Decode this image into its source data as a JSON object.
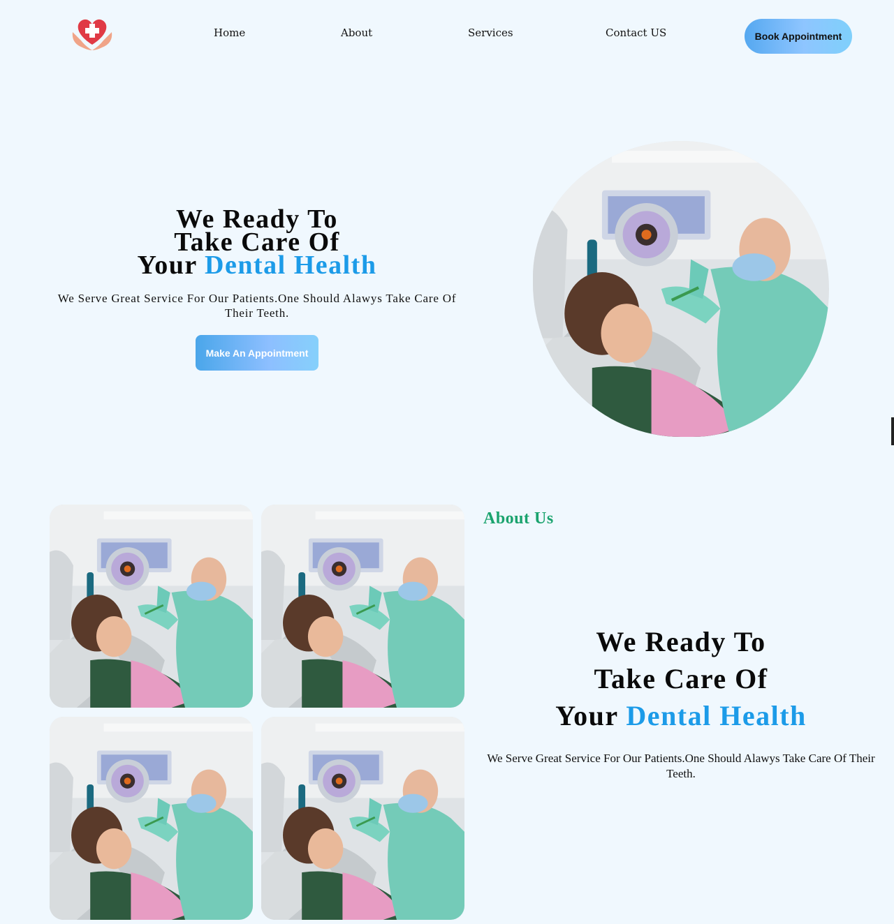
{
  "nav": {
    "links": [
      {
        "label": "Home"
      },
      {
        "label": "About"
      },
      {
        "label": "Services"
      },
      {
        "label": "Contact US"
      }
    ],
    "cta_label": "Book Appointment"
  },
  "hero": {
    "title_line1": "We Ready To",
    "title_line2": "Take Care Of",
    "title_line3_plain": "Your",
    "title_line3_accent": "Dental Health",
    "subtitle": "We Serve Great Service For Our Patients.One Should Alawys Take Care Of Their Teeth.",
    "button_label": "Make An Appointment"
  },
  "about": {
    "section_label": "About Us",
    "title_line1": "We Ready To",
    "title_line2": "Take Care Of",
    "title_line3_plain": "Your",
    "title_line3_accent": "Dental Health",
    "subtitle": "We Serve Great Service For Our Patients.One Should Alawys Take Care Of Their Teeth."
  },
  "colors": {
    "background": "#f0f8fe",
    "accent_blue": "#1c9be8",
    "accent_green": "#1aa36e",
    "logo_red": "#e03a45",
    "logo_hands": "#f0a488"
  },
  "icons": {
    "logo": "heart-cross-hands-icon"
  }
}
